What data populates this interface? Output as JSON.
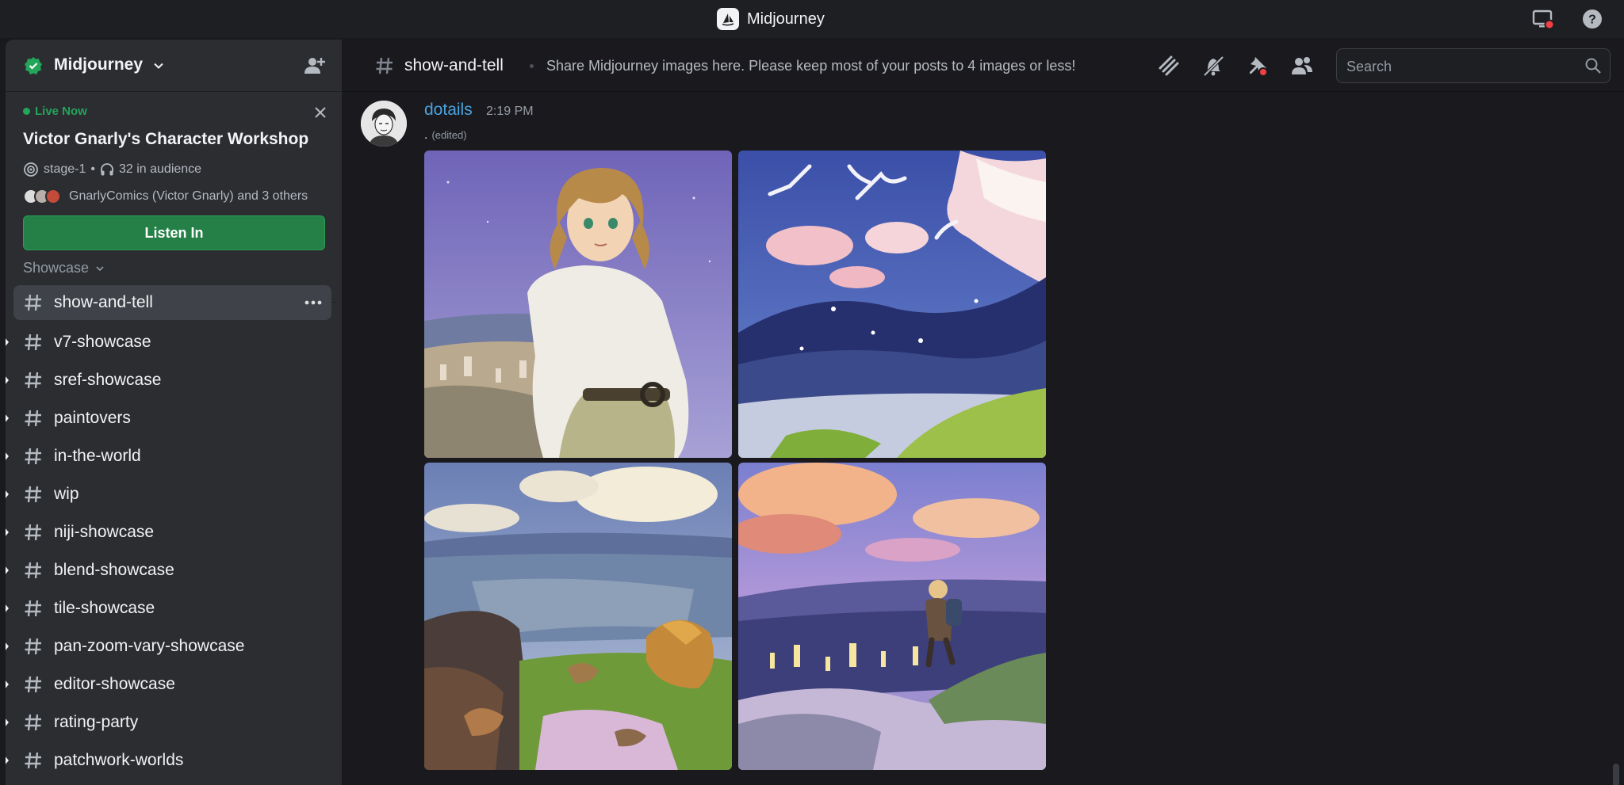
{
  "window": {
    "app_name": "Midjourney"
  },
  "server": {
    "name": "Midjourney"
  },
  "live_event": {
    "status": "Live Now",
    "title": "Victor Gnarly's Character Workshop",
    "stage": "stage-1",
    "audience": "32 in audience",
    "speakers": "GnarlyComics (Victor Gnarly) and 3 others",
    "button": "Listen In"
  },
  "category": {
    "label": "Showcase"
  },
  "channels": [
    {
      "name": "show-and-tell",
      "active": true
    },
    {
      "name": "v7-showcase"
    },
    {
      "name": "sref-showcase"
    },
    {
      "name": "paintovers"
    },
    {
      "name": "in-the-world"
    },
    {
      "name": "wip"
    },
    {
      "name": "niji-showcase"
    },
    {
      "name": "blend-showcase"
    },
    {
      "name": "tile-showcase"
    },
    {
      "name": "pan-zoom-vary-showcase"
    },
    {
      "name": "editor-showcase"
    },
    {
      "name": "rating-party"
    },
    {
      "name": "patchwork-worlds"
    }
  ],
  "header": {
    "channel_name": "show-and-tell",
    "topic": "Share Midjourney images here. Please keep most of your posts to 4 images or less!",
    "search_placeholder": "Search",
    "icons": [
      "threads-icon",
      "mute-icon",
      "pin-icon",
      "members-icon"
    ]
  },
  "message": {
    "author": "dotails",
    "timestamp": "2:19 PM",
    "content": ".",
    "edited": "(edited)",
    "attachments": [
      "girl-portrait-over-city",
      "birds-clouds-mountain-valley",
      "rocky-hillside-valley",
      "hiker-overlooking-city-at-dusk"
    ]
  },
  "colors": {
    "accent_green": "#248046",
    "live_green": "#23a55a",
    "author_blue": "#4aa3df",
    "notification_red": "#f23f43"
  }
}
